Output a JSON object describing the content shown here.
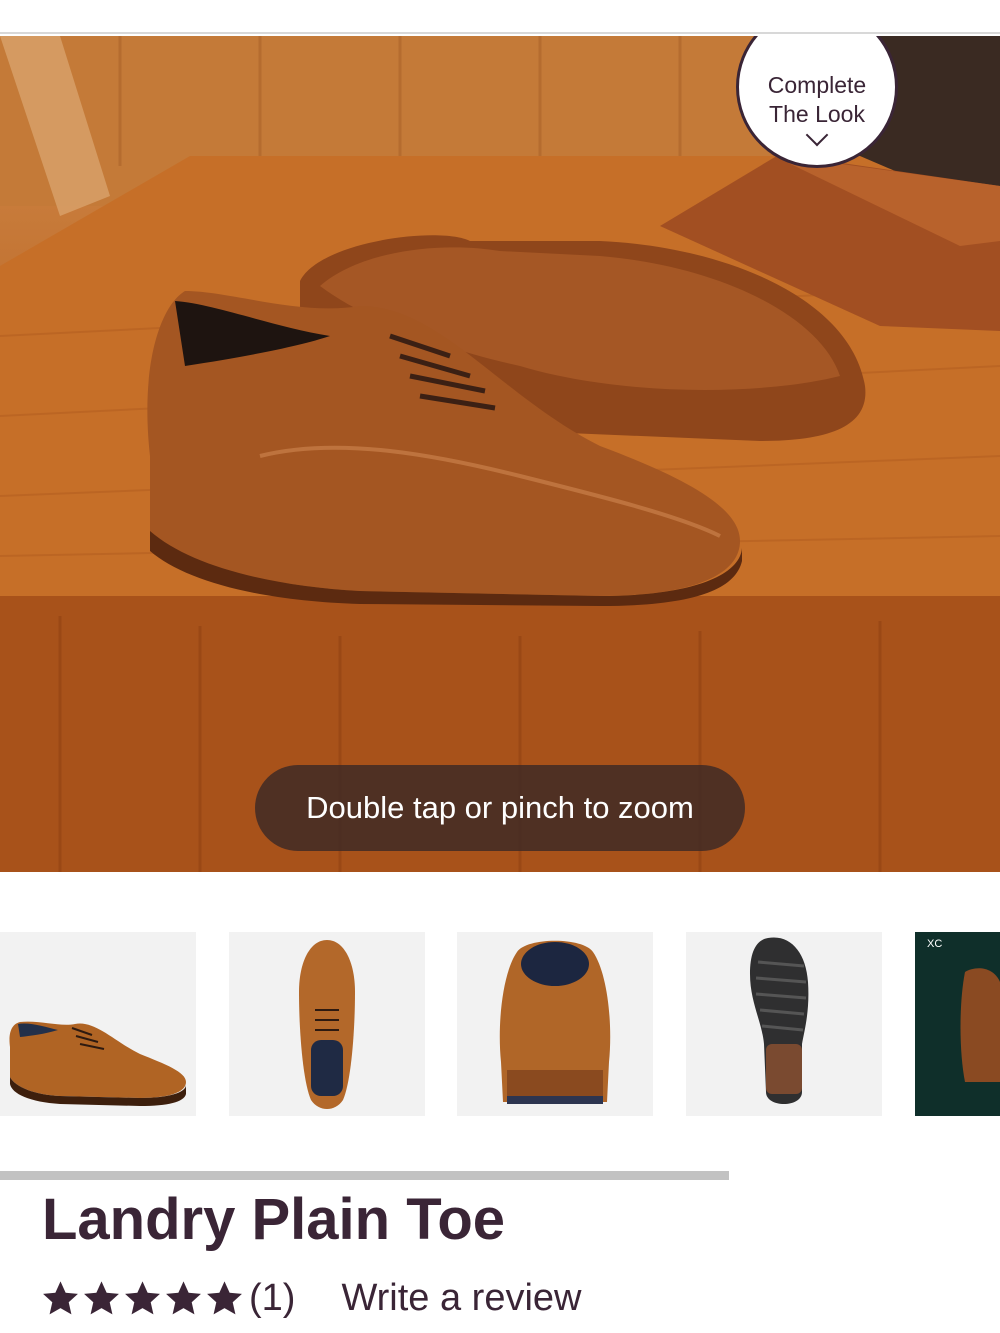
{
  "hero": {
    "complete_look_label": "Complete The Look",
    "zoom_hint": "Double tap or pinch to zoom"
  },
  "thumbnails": [
    {
      "view": "side"
    },
    {
      "view": "top"
    },
    {
      "view": "back"
    },
    {
      "view": "sole"
    },
    {
      "view": "promo",
      "label": "XC"
    }
  ],
  "product": {
    "title": "Landry Plain Toe",
    "rating_stars": 5,
    "review_count": "(1)",
    "write_review_label": "Write a review"
  },
  "colors": {
    "brand": "#3a2536",
    "leather": "#a85a24"
  }
}
